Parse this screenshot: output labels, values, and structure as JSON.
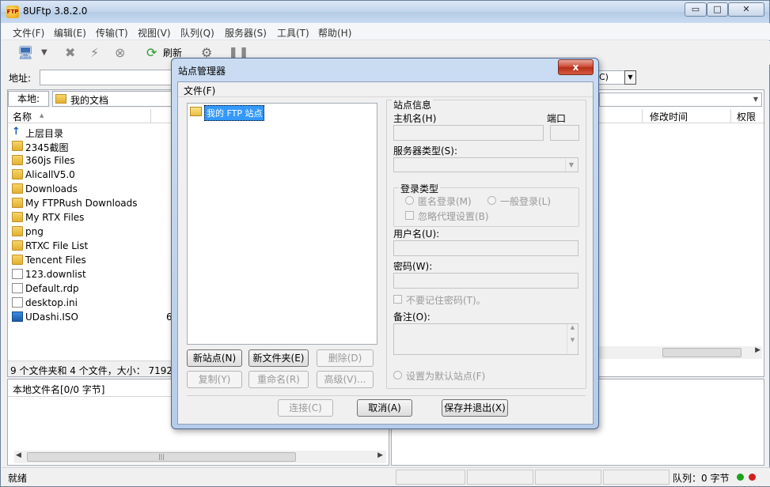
{
  "app": {
    "title": "8UFtp 3.8.2.0",
    "logo_text": "FTP",
    "caption": {
      "minimize": "▭",
      "maximize": "□",
      "close": "✕"
    }
  },
  "menu": [
    "文件(F)",
    "编辑(E)",
    "传输(T)",
    "视图(V)",
    "队列(Q)",
    "服务器(S)",
    "工具(T)",
    "帮助(H)"
  ],
  "toolbar": {
    "refresh_label": "刷新"
  },
  "address": {
    "label": "地址:",
    "value": "",
    "remote_combo_value": "C)"
  },
  "local": {
    "path_label": "本地:",
    "path_value": "我的文档",
    "columns": {
      "name": "名称",
      "sort_arrow": "▲"
    },
    "items": [
      {
        "name": "上层目录",
        "type": "up"
      },
      {
        "name": "2345截图",
        "type": "folder"
      },
      {
        "name": "360js Files",
        "type": "folder"
      },
      {
        "name": "AlicallV5.0",
        "type": "folder"
      },
      {
        "name": "Downloads",
        "type": "folder"
      },
      {
        "name": "My FTPRush Downloads",
        "type": "folder"
      },
      {
        "name": "My RTX Files",
        "type": "folder"
      },
      {
        "name": "png",
        "type": "folder"
      },
      {
        "name": "RTXC File List",
        "type": "folder"
      },
      {
        "name": "Tencent Files",
        "type": "folder"
      },
      {
        "name": "123.downlist",
        "type": "file"
      },
      {
        "name": "Default.rdp",
        "type": "file"
      },
      {
        "name": "desktop.ini",
        "type": "file"
      },
      {
        "name": "UDashi.ISO",
        "type": "iso",
        "size_partial": "6"
      }
    ],
    "status": "9 个文件夹和 4 个文件，大小：  7192"
  },
  "remote": {
    "columns": {
      "modified": "修改时间",
      "perm": "权限"
    }
  },
  "queue": {
    "header": "本地文件名[0/0 字节]",
    "scroll_grip": "|||"
  },
  "statusbar": {
    "ready": "就绪",
    "queue": "队列：0 字节",
    "dot_green": "#1aa31a",
    "dot_red": "#d02020"
  },
  "dialog": {
    "title": "站点管理器",
    "close": "x",
    "menu_file": "文件(F)",
    "tree_root": "我的 FTP 站点",
    "buttons": {
      "new_site": "新站点(N)",
      "new_folder": "新文件夹(E)",
      "delete": "删除(D)",
      "copy": "复制(Y)",
      "rename": "重命名(R)",
      "advanced": "高级(V)...",
      "connect": "连接(C)",
      "cancel": "取消(A)",
      "save_exit": "保存并退出(X)"
    },
    "site_info": {
      "legend": "站点信息",
      "host_label": "主机名(H)",
      "port_label": "端口",
      "server_type_label": "服务器类型(S):",
      "login_type_legend": "登录类型",
      "anonymous": "匿名登录(M)",
      "normal": "一般登录(L)",
      "ignore_proxy": "忽略代理设置(B)",
      "username_label": "用户名(U):",
      "password_label": "密码(W):",
      "no_remember": "不要记住密码(T)。",
      "note_label": "备注(O):",
      "default_site": "设置为默认站点(F)"
    }
  }
}
